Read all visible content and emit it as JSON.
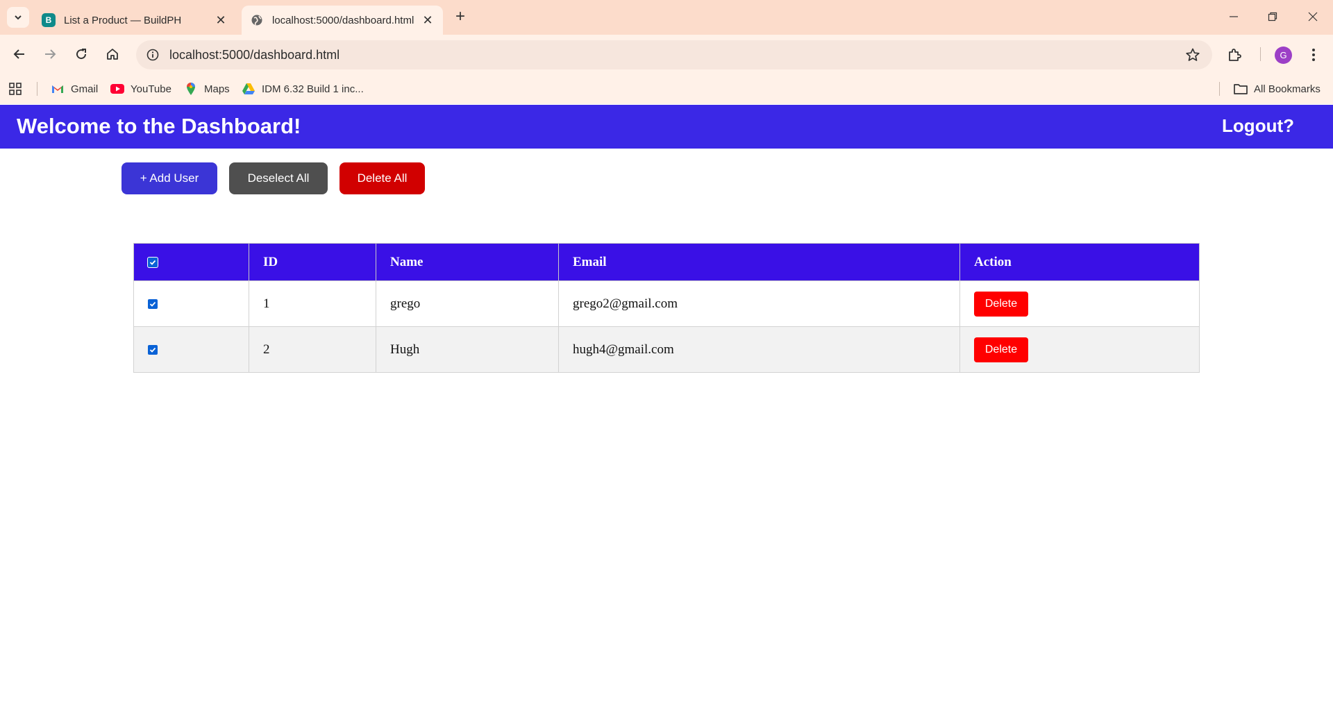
{
  "browser": {
    "tabs": [
      {
        "title": "List a Product — BuildPH",
        "favicon": "B",
        "active": false
      },
      {
        "title": "localhost:5000/dashboard.html",
        "active": true
      }
    ],
    "url": "localhost:5000/dashboard.html",
    "profile_initial": "G",
    "bookmarks": [
      {
        "label": "Gmail",
        "icon": "gmail-icon"
      },
      {
        "label": "YouTube",
        "icon": "youtube-icon"
      },
      {
        "label": "Maps",
        "icon": "maps-icon"
      },
      {
        "label": "IDM 6.32 Build 1 inc...",
        "icon": "drive-icon"
      }
    ],
    "all_bookmarks": "All Bookmarks"
  },
  "header": {
    "title": "Welcome to the Dashboard!",
    "logout": "Logout?"
  },
  "actions": {
    "add_user": "+ Add User",
    "deselect_all": "Deselect All",
    "delete_all": "Delete All"
  },
  "table": {
    "columns": [
      "ID",
      "Name",
      "Email",
      "Action"
    ],
    "rows": [
      {
        "id": "1",
        "name": "grego",
        "email": "grego2@gmail.com",
        "action": "Delete",
        "checked": true
      },
      {
        "id": "2",
        "name": "Hugh",
        "email": "hugh4@gmail.com",
        "action": "Delete",
        "checked": true
      }
    ]
  },
  "colors": {
    "header_bg": "#3b28e6",
    "table_header_bg": "#3a10e6",
    "add_button": "#3b35d6",
    "deselect_button": "#4f4f4f",
    "delete_all_button": "#d10000",
    "row_delete_button": "#ff0000"
  }
}
